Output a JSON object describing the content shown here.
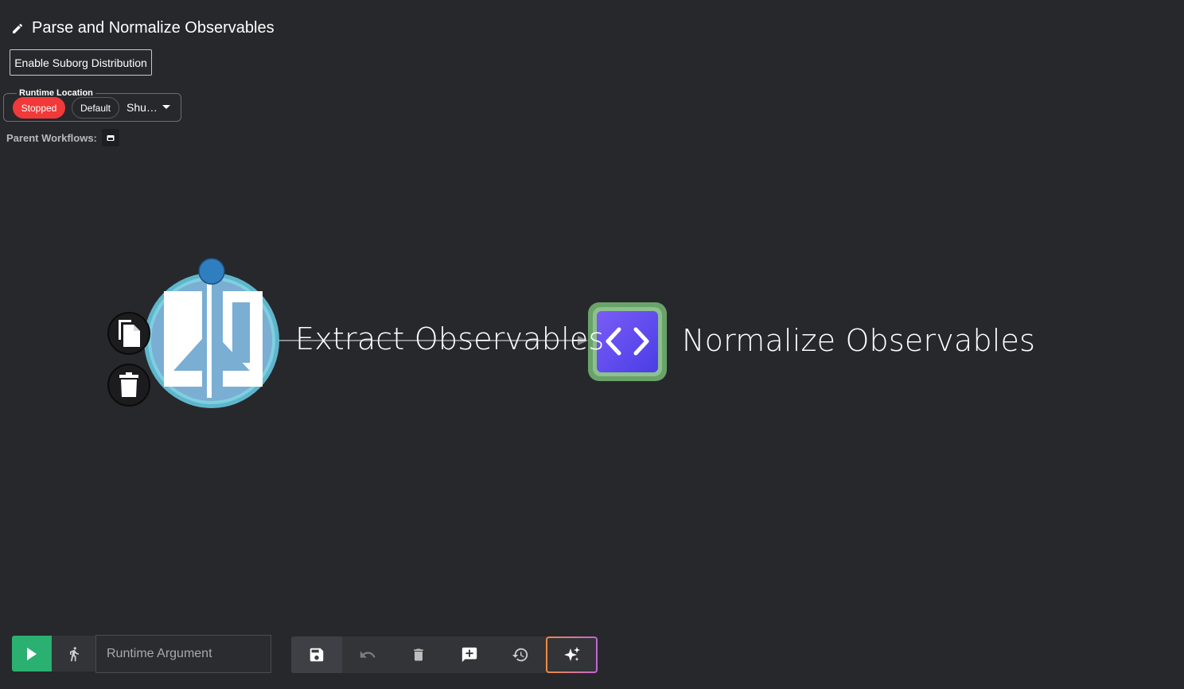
{
  "workflow": {
    "title": "Parse and Normalize Observables",
    "suborg_button": "Enable Suborg Distribution"
  },
  "runtime": {
    "label": "Runtime Location",
    "status": "Stopped",
    "environment": "Default",
    "selected_location": "Shu…"
  },
  "parent_workflows": {
    "label": "Parent Workflows:"
  },
  "nodes": {
    "start_node": "Extract Observables",
    "next_node": "Normalize Observables"
  },
  "toolbar": {
    "argument_placeholder": "Runtime Argument"
  },
  "colors": {
    "background": "#27282c",
    "run": "#2ab071",
    "stopped": "#f1393a",
    "node_ring": "#7fcfe0",
    "node_fill": "#7aaed2",
    "code_node_border": "#6aa36a",
    "code_node_fill": "#5b4cf0",
    "start_dot": "#2f7fc0"
  },
  "icons": [
    "pencil-icon",
    "folder-icon",
    "copy-icon",
    "trash-icon",
    "code-icon",
    "play-icon",
    "step-icon",
    "save-icon",
    "undo-icon",
    "delete-icon",
    "comment-icon",
    "history-icon",
    "sparkle-icon"
  ]
}
